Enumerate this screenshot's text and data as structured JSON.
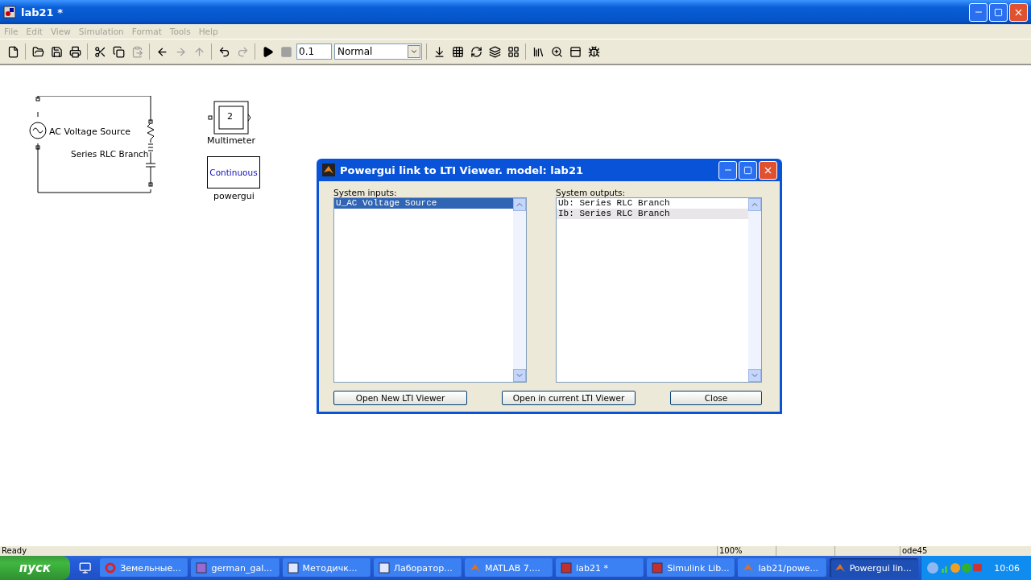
{
  "window": {
    "title": "lab21 *"
  },
  "menu": [
    "File",
    "Edit",
    "View",
    "Simulation",
    "Format",
    "Tools",
    "Help"
  ],
  "toolbar": [
    {
      "kind": "new",
      "disabled": false
    },
    {
      "kind": "sep"
    },
    {
      "kind": "open",
      "disabled": false
    },
    {
      "kind": "save",
      "disabled": false
    },
    {
      "kind": "print",
      "disabled": false
    },
    {
      "kind": "sep"
    },
    {
      "kind": "cut",
      "disabled": false
    },
    {
      "kind": "copy",
      "disabled": false
    },
    {
      "kind": "paste",
      "disabled": true
    },
    {
      "kind": "sep"
    },
    {
      "kind": "back",
      "disabled": false
    },
    {
      "kind": "forward",
      "disabled": true
    },
    {
      "kind": "up",
      "disabled": true
    },
    {
      "kind": "sep"
    },
    {
      "kind": "undo",
      "disabled": false
    },
    {
      "kind": "redo",
      "disabled": true
    },
    {
      "kind": "sep"
    },
    {
      "kind": "play",
      "disabled": false
    },
    {
      "kind": "stop",
      "disabled": true
    }
  ],
  "stop_time": "0.1",
  "sim_mode": "Normal",
  "toolbar2": [
    {
      "kind": "update",
      "disabled": false
    },
    {
      "kind": "build",
      "disabled": false
    },
    {
      "kind": "refresh",
      "disabled": false
    },
    {
      "kind": "layers",
      "disabled": false
    },
    {
      "kind": "grid",
      "disabled": false
    },
    {
      "kind": "sep"
    },
    {
      "kind": "library",
      "disabled": false
    },
    {
      "kind": "zoom",
      "disabled": false
    },
    {
      "kind": "explorer",
      "disabled": false
    },
    {
      "kind": "debug",
      "disabled": false
    }
  ],
  "diagram": {
    "source_label": "AC Voltage Source",
    "branch_label": "Series RLC Branch",
    "multimeter_value": "2",
    "multimeter_label": "Multimeter",
    "powergui_text": "Continuous",
    "powergui_label": "powergui"
  },
  "dialog": {
    "title": "Powergui link to LTI Viewer.  model: lab21",
    "inputs": {
      "label": "System inputs:",
      "focused": true,
      "items": [
        {
          "text": "U_AC Voltage Source",
          "selected": true
        }
      ]
    },
    "outputs": {
      "label": "System outputs:",
      "focused": false,
      "items": [
        {
          "text": "Ub: Series RLC Branch",
          "selected": false
        },
        {
          "text": "Ib: Series RLC Branch",
          "selected": true
        }
      ]
    },
    "buttons": [
      "Open New LTI Viewer",
      "Open in current LTI Viewer",
      "Close"
    ]
  },
  "status_bar": {
    "text": "Ready",
    "zoom": "100%",
    "solver": "ode45"
  },
  "taskbar": {
    "start": "пуск",
    "tasks": [
      {
        "label": "Земельные...",
        "kind": "opera",
        "selected": false
      },
      {
        "label": "german_gal...",
        "kind": "image",
        "selected": false
      },
      {
        "label": "Методичк...",
        "kind": "word",
        "selected": false
      },
      {
        "label": "Лаборатор...",
        "kind": "word",
        "selected": false
      },
      {
        "label": "MATLAB  7....",
        "kind": "matlab",
        "selected": false
      },
      {
        "label": "lab21 *",
        "kind": "simulink",
        "selected": false
      },
      {
        "label": "Simulink Lib...",
        "kind": "simulink",
        "selected": false
      },
      {
        "label": "lab21/powe...",
        "kind": "matlab",
        "selected": false
      },
      {
        "label": "Powergui lin...",
        "kind": "matlab",
        "selected": true
      }
    ],
    "clock": "10:06"
  }
}
